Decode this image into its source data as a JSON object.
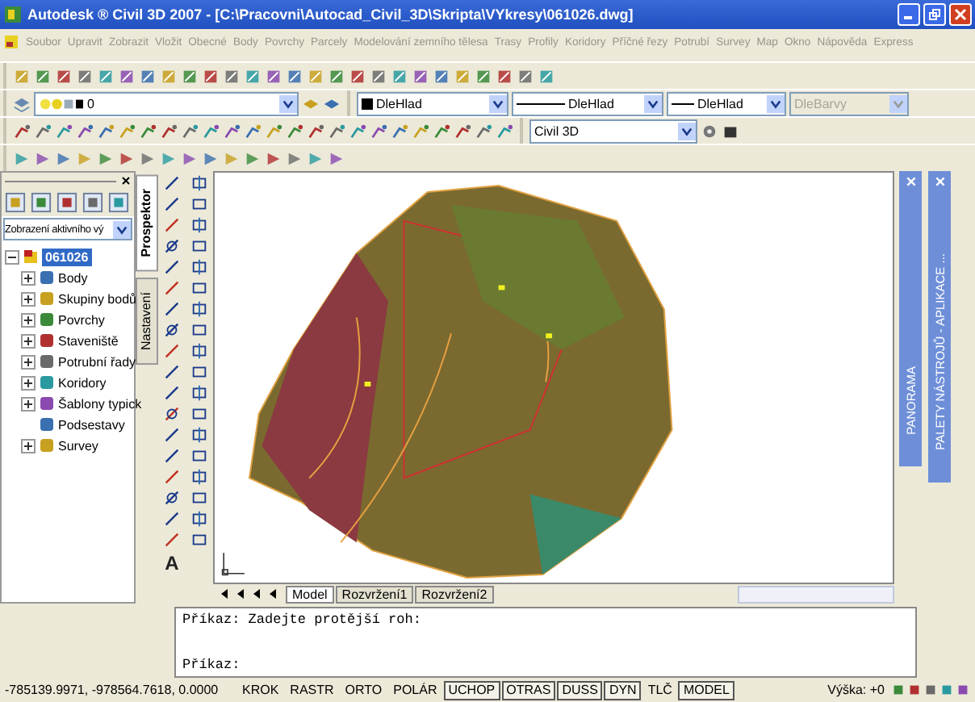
{
  "window": {
    "title": "Autodesk ® Civil 3D 2007 - [C:\\Pracovni\\Autocad_Civil_3D\\Skripta\\VYkresy\\061026.dwg]"
  },
  "menu": [
    "Soubor",
    "Upravit",
    "Zobrazit",
    "Vložit",
    "Obecné",
    "Body",
    "Povrchy",
    "Parcely",
    "Modelování zemního tělesa",
    "Trasy",
    "Profily",
    "Koridory",
    "Příčné řezy",
    "Potrubí",
    "Survey",
    "Map",
    "Okno",
    "Nápověda",
    "Express"
  ],
  "properties": {
    "layer": "0",
    "color_setting": "DleHlad",
    "linetype": "DleHlad",
    "lineweight": "DleHlad",
    "plot_style": {
      "value": "DleBarvy",
      "disabled": true
    }
  },
  "workspace": "Civil 3D",
  "prospector": {
    "view": "Zobrazení aktivního vý",
    "root": {
      "label": "061026",
      "selected": true,
      "children": [
        {
          "label": "Body",
          "expandable": true
        },
        {
          "label": "Skupiny bodů",
          "expandable": true
        },
        {
          "label": "Povrchy",
          "expandable": true
        },
        {
          "label": "Staveniště",
          "expandable": true
        },
        {
          "label": "Potrubní řady",
          "expandable": true
        },
        {
          "label": "Koridory",
          "expandable": true
        },
        {
          "label": "Šablony typick",
          "expandable": true
        },
        {
          "label": "Podsestavy",
          "expandable": false
        },
        {
          "label": "Survey",
          "expandable": true
        }
      ]
    },
    "tabs": [
      {
        "label": "Prospektor",
        "selected": true
      },
      {
        "label": "Nastavení",
        "selected": false
      }
    ]
  },
  "layout_tabs": [
    {
      "label": "Model",
      "selected": true
    },
    {
      "label": "Rozvržení1",
      "selected": false
    },
    {
      "label": "Rozvržení2",
      "selected": false
    }
  ],
  "text_tool": "A",
  "palettes": [
    "PANORAMA",
    "PALETY NÁSTROJŮ - APLIKACE ..."
  ],
  "command_lines": [
    "Příkaz: Zadejte protější roh:",
    "Příkaz:"
  ],
  "status_bar": {
    "coordinates": "-785139.9971, -978564.7618, 0.0000",
    "toggles": [
      {
        "label": "KROK",
        "on": false
      },
      {
        "label": "RASTR",
        "on": false
      },
      {
        "label": "ORTO",
        "on": false
      },
      {
        "label": "POLÁR",
        "on": false
      },
      {
        "label": "UCHOP",
        "on": true
      },
      {
        "label": "OTRAS",
        "on": true
      },
      {
        "label": "DUSS",
        "on": true
      },
      {
        "label": "DYN",
        "on": true
      },
      {
        "label": "TLČ",
        "on": false
      },
      {
        "label": "MODEL",
        "on": true
      }
    ],
    "elevation": "Výška: +0"
  }
}
